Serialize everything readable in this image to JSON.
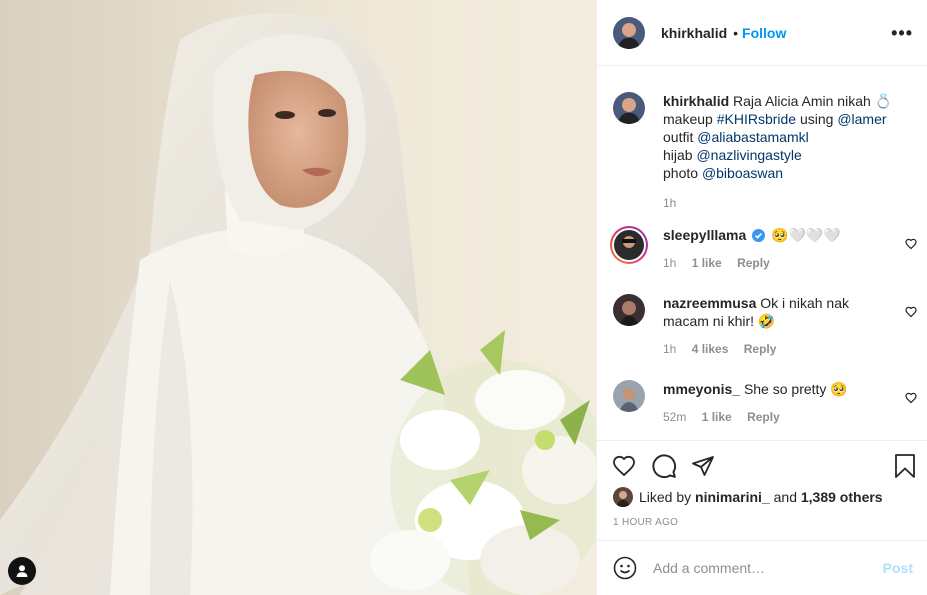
{
  "header": {
    "username": "khirkhalid",
    "separator": "•",
    "follow_label": "Follow",
    "more_icon": "more-dots-icon"
  },
  "caption": {
    "username": "khirkhalid",
    "line1_text": "Raja Alicia Amin nikah 💍",
    "line2_prefix": "makeup ",
    "line2_tag": "#KHIRsbride",
    "line2_mid": " using ",
    "line2_mention": "@lamer",
    "line3_prefix": "outfit ",
    "line3_mention": "@aliabastamamkl",
    "line4_prefix": "hijab ",
    "line4_mention": "@nazlivingastyle",
    "line5_prefix": "photo ",
    "line5_mention": "@biboaswan",
    "time": "1h"
  },
  "comments": [
    {
      "username": "sleepylllama",
      "verified": true,
      "text": "🥺🤍🤍🤍",
      "time": "1h",
      "likes": "1 like",
      "reply": "Reply"
    },
    {
      "username": "nazreemmusa",
      "verified": false,
      "text": "Ok i nikah nak macam ni khir! 🤣",
      "time": "1h",
      "likes": "4 likes",
      "reply": "Reply"
    },
    {
      "username": "mmeyonis_",
      "verified": false,
      "text": "She so pretty 🥺",
      "time": "52m",
      "likes": "1 like",
      "reply": "Reply"
    }
  ],
  "liked_by": {
    "prefix": "Liked by ",
    "user": "ninimarini_",
    "middle": " and ",
    "others": "1,389 others"
  },
  "post_time": "1 HOUR AGO",
  "add_comment": {
    "placeholder": "Add a comment…",
    "post_label": "Post"
  },
  "colors": {
    "accent": "#0095f6",
    "link": "#00376b",
    "muted": "#8e8e8e",
    "post_disabled": "#b2dffc"
  }
}
